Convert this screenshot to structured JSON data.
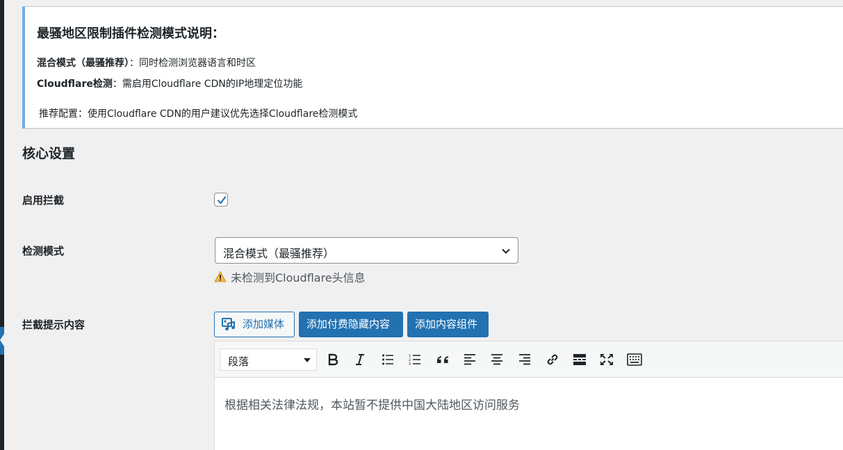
{
  "notice": {
    "title": "最骚地区限制插件检测模式说明：",
    "line1_bold": "混合模式（最骚推荐）",
    "line1_text": "：同时检测浏览器语言和时区",
    "line2_bold": "Cloudflare检测",
    "line2_text": "：需启用Cloudflare CDN的IP地理定位功能",
    "line3": "推荐配置：使用Cloudflare CDN的用户建议优先选择Cloudflare检测模式"
  },
  "section": {
    "title": "核心设置"
  },
  "fields": {
    "enable_label": "启用拦截",
    "enable_checked": true,
    "mode_label": "检测模式",
    "mode_value": "混合模式（最骚推荐）",
    "mode_warning": "未检测到Cloudflare头信息",
    "content_label": "拦截提示内容"
  },
  "buttons": {
    "add_media": "添加媒体",
    "add_paid": "添加付费隐藏内容",
    "add_widget": "添加内容组件"
  },
  "editor": {
    "format_value": "段落",
    "toolbar_icons": [
      "bold-icon",
      "italic-icon",
      "bullet-list-icon",
      "numbered-list-icon",
      "blockquote-icon",
      "align-left-icon",
      "align-center-icon",
      "align-right-icon",
      "link-icon",
      "read-more-icon",
      "fullscreen-icon",
      "toolbar-toggle-icon"
    ],
    "content": "根据相关法律法规，本站暂不提供中国大陆地区访问服务"
  },
  "colors": {
    "accent": "#2271b1",
    "notice_border": "#72aee6",
    "background": "#f0f0f1"
  }
}
